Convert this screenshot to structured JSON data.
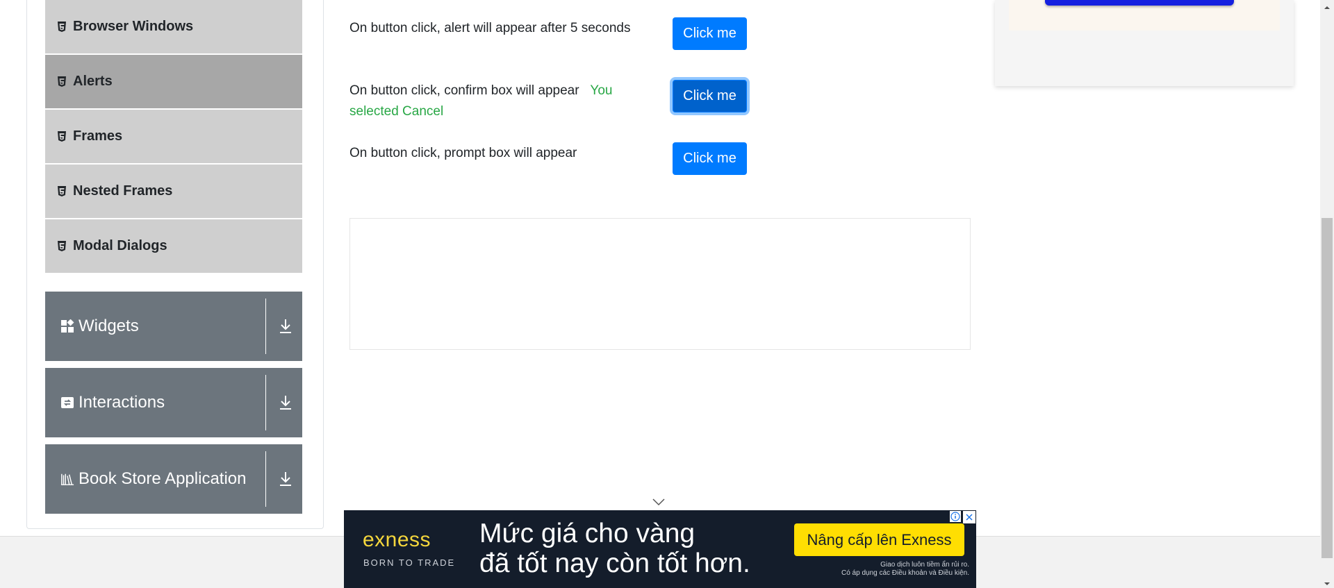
{
  "sidebar": {
    "items": [
      {
        "label": "Browser Windows",
        "active": false,
        "icon": "html5-icon"
      },
      {
        "label": "Alerts",
        "active": true,
        "icon": "html5-icon"
      },
      {
        "label": "Frames",
        "active": false,
        "icon": "html5-icon"
      },
      {
        "label": "Nested Frames",
        "active": false,
        "icon": "html5-icon"
      },
      {
        "label": "Modal Dialogs",
        "active": false,
        "icon": "html5-icon"
      }
    ],
    "groups": [
      {
        "label": "Widgets",
        "icon": "widgets-icon"
      },
      {
        "label": "Interactions",
        "icon": "interactions-icon"
      },
      {
        "label": "Book Store Application",
        "icon": "bookstore-icon"
      }
    ]
  },
  "main": {
    "timer_alert": {
      "text": "On button click, alert will appear after 5 seconds",
      "button": "Click me"
    },
    "confirm": {
      "text": "On button click, confirm box will appear",
      "result": "You selected Cancel",
      "button": "Click me"
    },
    "prompt": {
      "text": "On button click, prompt box will appear",
      "button": "Click me"
    }
  },
  "banner": {
    "logo": "exness",
    "slogan": "BORN TO TRADE",
    "headline_1": "Mức giá cho vàng",
    "headline_2": "đã tốt nay còn tốt hơn.",
    "cta": "Nâng cấp lên Exness",
    "disclaimer_1": "Giao dịch luôn tiềm ẩn rủi ro.",
    "disclaimer_2": "Có áp dụng các Điều khoản và Điều kiện."
  },
  "colors": {
    "primary": "#007bff",
    "success": "#28a745",
    "sidebar_item": "#cfcfcf",
    "sidebar_active": "#a7a7a7",
    "group": "#6c757d",
    "banner_bg": "#141d2b",
    "banner_accent": "#ffde02"
  }
}
